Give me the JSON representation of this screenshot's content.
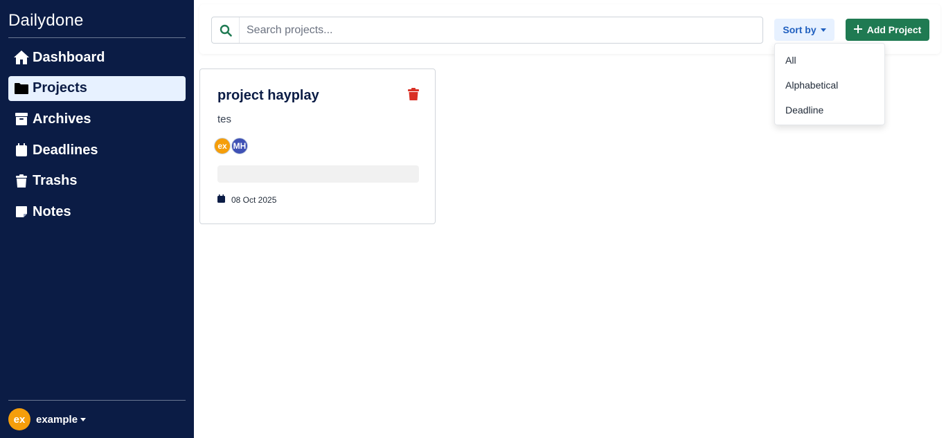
{
  "app": {
    "brand": "Dailydone"
  },
  "sidebar": {
    "items": [
      {
        "label": "Dashboard",
        "icon": "home-icon",
        "active": false
      },
      {
        "label": "Projects",
        "icon": "folder-icon",
        "active": true
      },
      {
        "label": "Archives",
        "icon": "archive-icon",
        "active": false
      },
      {
        "label": "Deadlines",
        "icon": "calendar-icon",
        "active": false
      },
      {
        "label": "Trashs",
        "icon": "trash-icon",
        "active": false
      },
      {
        "label": "Notes",
        "icon": "note-icon",
        "active": false
      }
    ],
    "user": {
      "initials": "ex",
      "name": "example"
    }
  },
  "toolbar": {
    "search_placeholder": "Search projects...",
    "sort_label": "Sort by",
    "add_label": "Add Project"
  },
  "sort_menu": {
    "options": [
      "All",
      "Alphabetical",
      "Deadline"
    ]
  },
  "projects": [
    {
      "title": "project hayplay",
      "description": "tes",
      "members": [
        "ex",
        "MH"
      ],
      "progress": 0,
      "date": "08 Oct 2025"
    }
  ],
  "colors": {
    "sidebar_bg": "#0b1c45",
    "active_item_bg": "#e7f1ff",
    "primary_green": "#1f7a52",
    "sort_blue": "#1f5fbf",
    "danger_red": "#d93025",
    "avatar_orange": "#f59e0b",
    "avatar_indigo": "#3f51b5"
  }
}
